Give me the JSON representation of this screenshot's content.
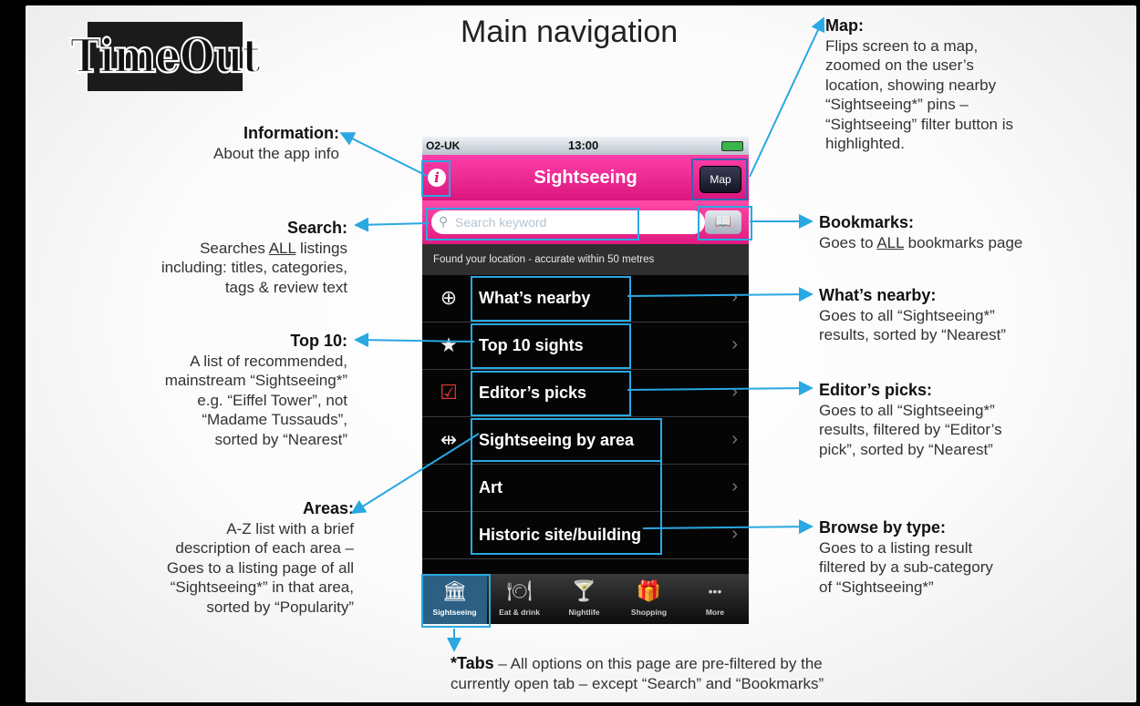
{
  "logo": {
    "text": "TimeOut"
  },
  "title": "Main navigation",
  "annotations": {
    "information": {
      "heading": "Information:",
      "line1": "About the app info"
    },
    "search": {
      "heading": "Search:",
      "line1_pre": "Searches ",
      "line1_u": "ALL",
      "line1_post": " listings",
      "line2": "including: titles, categories,",
      "line3": "tags & review text"
    },
    "top10": {
      "heading": "Top 10:",
      "line1": "A list of recommended,",
      "line2": "mainstream “Sightseeing*”",
      "line3": "e.g. “Eiffel Tower”, not",
      "line4": "“Madame Tussauds”,",
      "line5": "sorted by “Nearest”"
    },
    "areas": {
      "heading": "Areas:",
      "line1": "A-Z list with a brief",
      "line2": "description of each area –",
      "line3": "Goes to a listing page of all",
      "line4": "“Sightseeing*” in that area,",
      "line5": "sorted by “Popularity”"
    },
    "map": {
      "heading": "Map:",
      "line1": "Flips screen to a map,",
      "line2": "zoomed on the user’s",
      "line3": "location, showing nearby",
      "line4": "“Sightseeing*” pins –",
      "line5": "“Sightseeing” filter button is",
      "line6": "highlighted."
    },
    "bookmarks": {
      "heading": "Bookmarks:",
      "line1_pre": "Goes to ",
      "line1_u": "ALL",
      "line1_post": " bookmarks page"
    },
    "nearby": {
      "heading": "What’s nearby:",
      "line1": "Goes to all “Sightseeing*”",
      "line2": "results, sorted by “Nearest”"
    },
    "editors": {
      "heading": "Editor’s picks:",
      "line1": "Goes to all “Sightseeing*”",
      "line2": "results, filtered by “Editor’s",
      "line3": "pick”, sorted by “Nearest”"
    },
    "browse": {
      "heading": "Browse by type:",
      "line1": "Goes to a listing result",
      "line2": "filtered by a sub-category",
      "line3": "of “Sightseeing*”"
    },
    "tabs": {
      "heading": "*Tabs",
      "line1": " – All options on this page are pre-filtered by the",
      "line2": "currently open tab – except “Search” and “Bookmarks”"
    }
  },
  "phone": {
    "carrier": "O2-UK",
    "time": "13:00",
    "nav_title": "Sightseeing",
    "info_label": "i",
    "map_label": "Map",
    "search_placeholder": "Search keyword",
    "location_text": "Found your location - accurate within 50 metres",
    "rows": [
      {
        "label": "What’s nearby",
        "icon": "crosshair-icon",
        "glyph": "⊕"
      },
      {
        "label": "Top 10 sights",
        "icon": "star-icon",
        "glyph": "★"
      },
      {
        "label": "Editor’s picks",
        "icon": "checkbox-icon",
        "glyph": "☑"
      },
      {
        "label": "Sightseeing by area",
        "icon": "signpost-icon",
        "glyph": "⇹"
      },
      {
        "label": "Art",
        "icon": "",
        "glyph": ""
      },
      {
        "label": "Historic site/building",
        "icon": "",
        "glyph": ""
      }
    ],
    "tabs": [
      {
        "label": "Sightseeing",
        "icon": "museum-icon",
        "glyph": "🏛"
      },
      {
        "label": "Eat & drink",
        "icon": "plate-icon",
        "glyph": "🍽"
      },
      {
        "label": "Nightlife",
        "icon": "glass-icon",
        "glyph": "🍸"
      },
      {
        "label": "Shopping",
        "icon": "gift-icon",
        "glyph": "🎁"
      },
      {
        "label": "More",
        "icon": "more-icon",
        "glyph": "•••"
      }
    ]
  },
  "colors": {
    "accent": "#29a8e2",
    "navbar": "#e91e8c",
    "tab_active": "#2b5f83"
  }
}
